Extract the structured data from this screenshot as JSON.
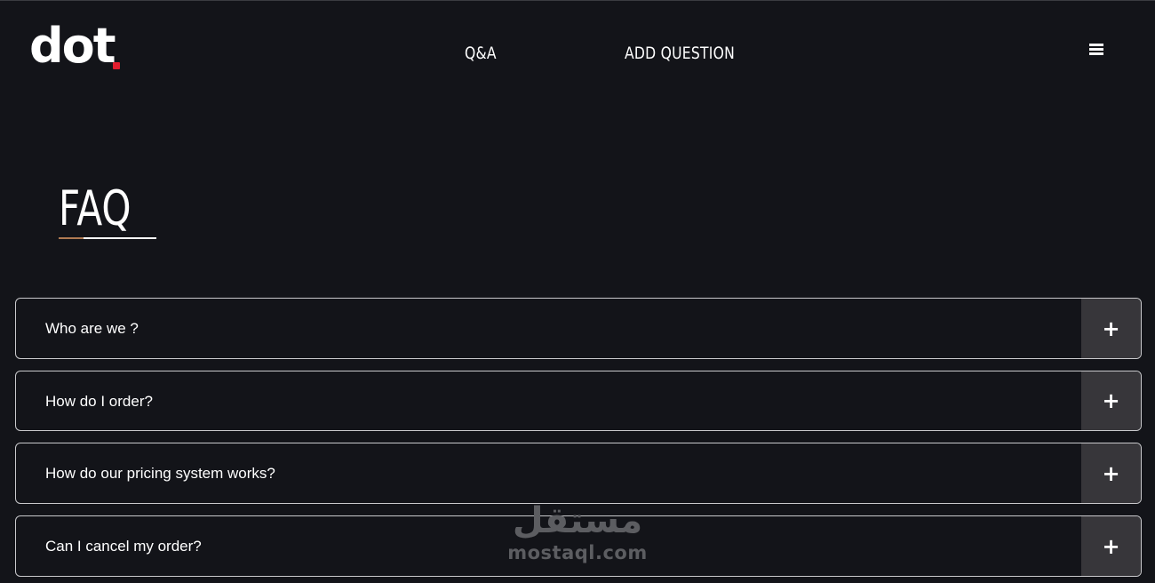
{
  "header": {
    "logo_text": "dot",
    "nav": {
      "qa_label": "Q&A",
      "add_question_label": "ADD QUESTION"
    },
    "menu_icon": "hamburger-menu-icon"
  },
  "colors": {
    "background": "#131419",
    "logo_dot": "#e11d2e",
    "title_accent": "#b07a52",
    "toggle_bg": "#37363a",
    "item_border": "#c9c9cc"
  },
  "faq": {
    "title": "FAQ",
    "items": [
      {
        "question": "Who are we ?",
        "toggle": "+"
      },
      {
        "question": "How do I order?",
        "toggle": "+"
      },
      {
        "question": "How do our pricing system works?",
        "toggle": "+"
      },
      {
        "question": "Can I cancel my order?",
        "toggle": "+"
      }
    ]
  },
  "watermark": {
    "arabic": "مستقل",
    "latin": "mostaql.com"
  }
}
